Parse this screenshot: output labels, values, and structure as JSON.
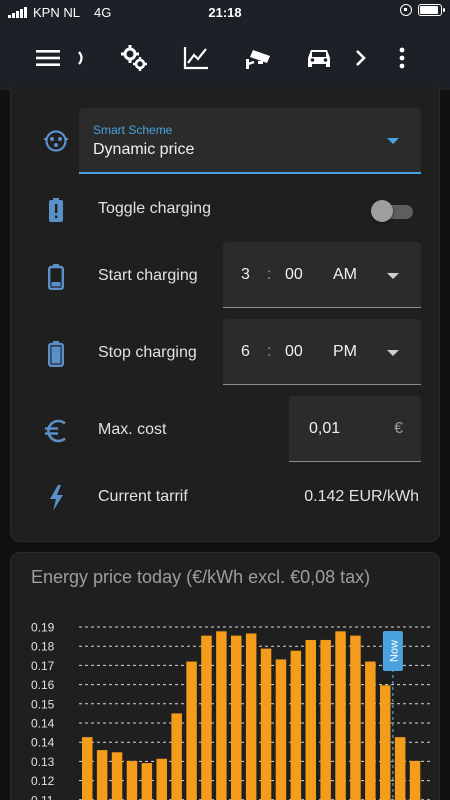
{
  "status_bar": {
    "carrier": "KPN NL",
    "network": "4G",
    "time": "21:18"
  },
  "nav": {
    "icons": [
      "menu-icon",
      "chevron-left-icon",
      "settings-icon",
      "chart-icon",
      "cctv-icon",
      "car-icon",
      "chevron-right-icon",
      "more-vert-icon"
    ],
    "active_tab": "car-icon"
  },
  "settings": {
    "smart_scheme": {
      "label": "Smart Scheme",
      "value": "Dynamic price"
    },
    "toggle_charging": {
      "label": "Toggle charging",
      "on": false
    },
    "start_charging": {
      "label": "Start charging",
      "hour": "3",
      "minute": "00",
      "ampm": "AM"
    },
    "stop_charging": {
      "label": "Stop charging",
      "hour": "6",
      "minute": "00",
      "ampm": "PM"
    },
    "max_cost": {
      "label": "Max. cost",
      "value": "0,01",
      "unit": "€"
    },
    "current_tariff": {
      "label": "Current tarrif",
      "value": "0.142 EUR/kWh"
    },
    "row_icons": [
      "ev-plug-icon",
      "battery-alert-icon",
      "battery-low-icon",
      "battery-high-icon",
      "euro-icon",
      "lightning-icon"
    ]
  },
  "chart_card": {
    "title": "Energy price today (€/kWh excl. €0,08 tax)",
    "now_label": "Now"
  },
  "colors": {
    "accent": "#4aa3df",
    "bar": "#f59c1a",
    "icon": "#5b8fc7"
  },
  "chart_data": {
    "type": "bar",
    "title": "Energy price today (€/kWh excl. €0,08 tax)",
    "y_ticks": [
      "0.19",
      "0.18",
      "0.17",
      "0.16",
      "0.15",
      "0.14",
      "0.14",
      "0.13",
      "0.12",
      "0.11"
    ],
    "ylim": [
      0.11,
      0.19
    ],
    "grid": true,
    "values": [
      0.139,
      0.133,
      0.132,
      0.128,
      0.127,
      0.129,
      0.15,
      0.174,
      0.186,
      0.188,
      0.186,
      0.187,
      0.18,
      0.175,
      0.179,
      0.184,
      0.184,
      0.188,
      0.186,
      0.174,
      0.163,
      0.139,
      0.128
    ],
    "now_index": 21
  }
}
